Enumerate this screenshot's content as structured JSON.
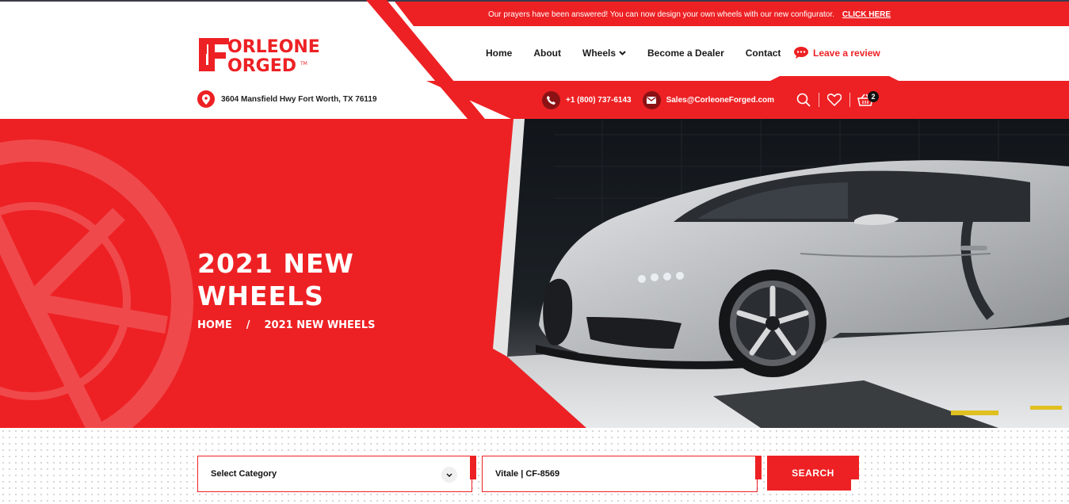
{
  "announcement": {
    "text": "Our prayers have been answered! You can now design your own wheels with our new configurator.",
    "cta": "CLICK HERE"
  },
  "brand": {
    "line1": "ORLEONE",
    "line2": "ORGED",
    "tm": "TM",
    "colors": {
      "accent": "#ed2124",
      "dark": "#8b1214",
      "text": "#1a1a1a"
    }
  },
  "address": "3604 Mansfield Hwy Fort Worth, TX 76119",
  "nav": {
    "items": [
      "Home",
      "About",
      "Wheels",
      "Become a Dealer",
      "Contact"
    ],
    "review": "Leave a review"
  },
  "contact": {
    "phone": "+1 (800) 737-6143",
    "email": "Sales@CorleoneForged.com"
  },
  "tools": {
    "icons": [
      "search-icon",
      "heart-icon",
      "basket-icon"
    ],
    "cart_count": "2"
  },
  "hero": {
    "title_line1": "2021 NEW",
    "title_line2": "WHEELS",
    "breadcrumb_home": "HOME",
    "breadcrumb_sep": "/",
    "breadcrumb_current": "2021 NEW WHEELS"
  },
  "search": {
    "category_value": "Select Category",
    "query_value": "Vitale | CF-8569",
    "button": "SEARCH"
  }
}
